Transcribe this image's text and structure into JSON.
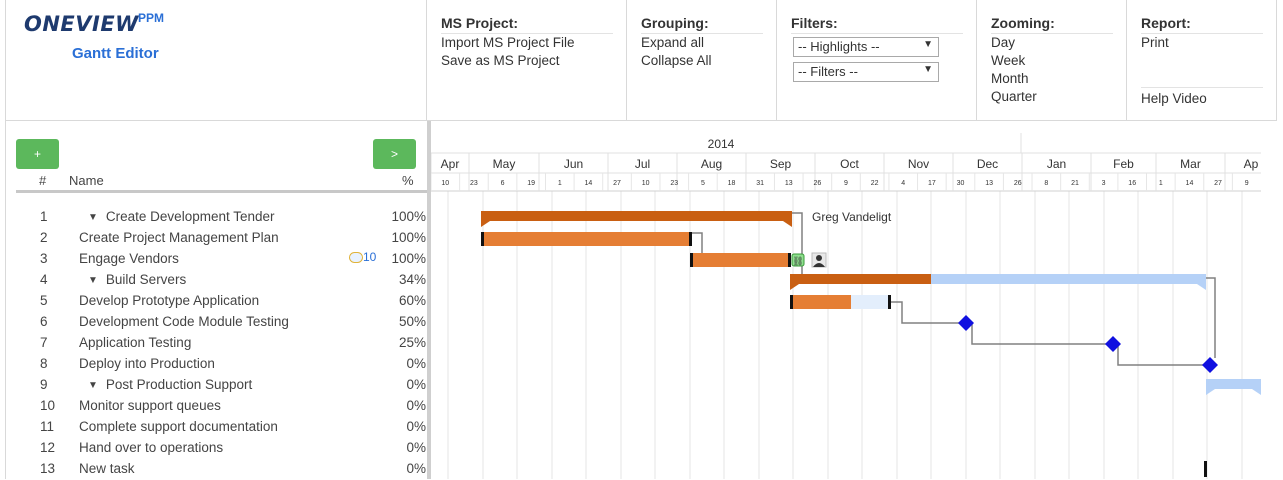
{
  "logo": {
    "brand": "ONEVIEW",
    "superscript": "PPM",
    "subtitle": "Gantt Editor"
  },
  "toolbar": {
    "ms_project": {
      "title": "MS Project:",
      "import": "Import MS Project File",
      "save": "Save as MS Project"
    },
    "grouping": {
      "title": "Grouping:",
      "expand": "Expand all",
      "collapse": "Collapse All"
    },
    "filters": {
      "title": "Filters:",
      "highlights": "-- Highlights --",
      "filters": "-- Filters --"
    },
    "zooming": {
      "title": "Zooming:",
      "day": "Day",
      "week": "Week",
      "month": "Month",
      "quarter": "Quarter"
    },
    "report": {
      "title": "Report:",
      "print": "Print",
      "help": "Help Video"
    }
  },
  "grid": {
    "add_label": "+",
    "next_label": ">",
    "col_num": "#",
    "col_name": "Name",
    "col_pct": "%"
  },
  "tasks": [
    {
      "num": "1",
      "name": "Create Development Tender",
      "pct": "100%",
      "summary": true
    },
    {
      "num": "2",
      "name": "Create Project Management Plan",
      "pct": "100%"
    },
    {
      "num": "3",
      "name": "Engage Vendors",
      "pct": "100%",
      "comments": "10"
    },
    {
      "num": "4",
      "name": "Build Servers",
      "pct": "34%",
      "summary": true
    },
    {
      "num": "5",
      "name": "Develop Prototype Application",
      "pct": "60%"
    },
    {
      "num": "6",
      "name": "Development Code Module Testing",
      "pct": "50%"
    },
    {
      "num": "7",
      "name": "Application Testing",
      "pct": "25%"
    },
    {
      "num": "8",
      "name": "Deploy into Production",
      "pct": "0%"
    },
    {
      "num": "9",
      "name": "Post Production Support",
      "pct": "0%",
      "summary": true
    },
    {
      "num": "10",
      "name": "Monitor support queues",
      "pct": "0%"
    },
    {
      "num": "11",
      "name": "Complete support documentation",
      "pct": "0%"
    },
    {
      "num": "12",
      "name": "Hand over to operations",
      "pct": "0%"
    },
    {
      "num": "13",
      "name": "New task",
      "pct": "0%"
    }
  ],
  "timeline": {
    "year": "2014",
    "months": [
      "Apr",
      "May",
      "Jun",
      "Jul",
      "Aug",
      "Sep",
      "Oct",
      "Nov",
      "Dec",
      "Jan",
      "Feb",
      "Mar",
      "Ap"
    ],
    "days": [
      "10",
      "23",
      "6",
      "19",
      "1",
      "14",
      "27",
      "10",
      "23",
      "5",
      "18",
      "31",
      "13",
      "26",
      "9",
      "22",
      "4",
      "17",
      "30",
      "13",
      "26",
      "8",
      "21",
      "3",
      "16",
      "1",
      "14",
      "27",
      "9"
    ]
  },
  "resource_label": "Greg Vandeligt",
  "colors": {
    "summary_done": "#c95f12",
    "task_done": "#e57e34",
    "task_remaining": "#e3eefc",
    "summary_remaining": "#b5d1f7",
    "milestone": "#1010e0",
    "link_line": "#808080",
    "add_button": "#5cb85c"
  }
}
